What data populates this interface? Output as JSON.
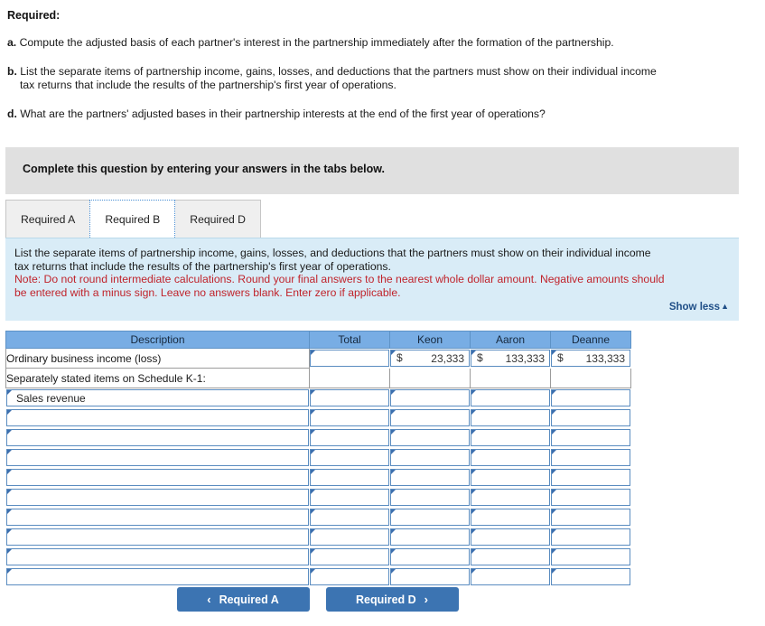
{
  "prompt": {
    "heading": "Required:",
    "items": [
      {
        "label": "a.",
        "text": "Compute the adjusted basis of each partner's interest in the partnership immediately after the formation of the partnership.",
        "cont": ""
      },
      {
        "label": "b.",
        "text": "List the separate items of partnership income, gains, losses, and deductions that the partners must show on their individual income",
        "cont": "tax returns that include the results of the partnership's first year of operations."
      },
      {
        "label": "d.",
        "text": "What are the partners' adjusted bases in their partnership interests at the end of the first year of operations?",
        "cont": ""
      }
    ]
  },
  "banner": {
    "text": "Complete this question by entering your answers in the tabs below."
  },
  "tabs": [
    {
      "label": "Required A",
      "active": false
    },
    {
      "label": "Required B",
      "active": true
    },
    {
      "label": "Required D",
      "active": false
    }
  ],
  "instructions": {
    "line1": "List the separate items of partnership income, gains, losses, and deductions that the partners must show on their individual income",
    "line2": "tax returns that include the results of the partnership's first year of operations.",
    "note1": "Note: Do not round intermediate calculations. Round your final answers to the nearest whole dollar amount. Negative amounts should",
    "note2": "be entered with a minus sign. Leave no answers blank. Enter zero if applicable.",
    "show_less": "Show less",
    "show_less_caret": "▲"
  },
  "table": {
    "headers": [
      "Description",
      "Total",
      "Keon",
      "Aaron",
      "Deanne"
    ],
    "rows": [
      {
        "kind": "static",
        "description": "Ordinary business income (loss)",
        "total": {
          "type": "input",
          "dollar": "",
          "value": ""
        },
        "keon": {
          "type": "input",
          "dollar": "$",
          "value": "23,333"
        },
        "aaron": {
          "type": "input",
          "dollar": "$",
          "value": "133,333"
        },
        "deanne": {
          "type": "input",
          "dollar": "$",
          "value": "133,333"
        }
      },
      {
        "kind": "static",
        "description": "Separately stated items on Schedule K-1:",
        "total": {
          "type": "blank"
        },
        "keon": {
          "type": "blank"
        },
        "aaron": {
          "type": "blank"
        },
        "deanne": {
          "type": "blank"
        }
      },
      {
        "kind": "input",
        "description": "   Sales revenue",
        "total": {
          "type": "input",
          "dollar": "",
          "value": ""
        },
        "keon": {
          "type": "input",
          "dollar": "",
          "value": ""
        },
        "aaron": {
          "type": "input",
          "dollar": "",
          "value": ""
        },
        "deanne": {
          "type": "input",
          "dollar": "",
          "value": ""
        }
      },
      {
        "kind": "input",
        "description": "",
        "total": {
          "type": "input",
          "dollar": "",
          "value": ""
        },
        "keon": {
          "type": "input",
          "dollar": "",
          "value": ""
        },
        "aaron": {
          "type": "input",
          "dollar": "",
          "value": ""
        },
        "deanne": {
          "type": "input",
          "dollar": "",
          "value": ""
        }
      },
      {
        "kind": "input",
        "description": "",
        "total": {
          "type": "input",
          "dollar": "",
          "value": ""
        },
        "keon": {
          "type": "input",
          "dollar": "",
          "value": ""
        },
        "aaron": {
          "type": "input",
          "dollar": "",
          "value": ""
        },
        "deanne": {
          "type": "input",
          "dollar": "",
          "value": ""
        }
      },
      {
        "kind": "input",
        "description": "",
        "total": {
          "type": "input",
          "dollar": "",
          "value": ""
        },
        "keon": {
          "type": "input",
          "dollar": "",
          "value": ""
        },
        "aaron": {
          "type": "input",
          "dollar": "",
          "value": ""
        },
        "deanne": {
          "type": "input",
          "dollar": "",
          "value": ""
        }
      },
      {
        "kind": "input",
        "description": "",
        "total": {
          "type": "input",
          "dollar": "",
          "value": ""
        },
        "keon": {
          "type": "input",
          "dollar": "",
          "value": ""
        },
        "aaron": {
          "type": "input",
          "dollar": "",
          "value": ""
        },
        "deanne": {
          "type": "input",
          "dollar": "",
          "value": ""
        }
      },
      {
        "kind": "input",
        "description": "",
        "total": {
          "type": "input",
          "dollar": "",
          "value": ""
        },
        "keon": {
          "type": "input",
          "dollar": "",
          "value": ""
        },
        "aaron": {
          "type": "input",
          "dollar": "",
          "value": ""
        },
        "deanne": {
          "type": "input",
          "dollar": "",
          "value": ""
        }
      },
      {
        "kind": "input",
        "description": "",
        "total": {
          "type": "input",
          "dollar": "",
          "value": ""
        },
        "keon": {
          "type": "input",
          "dollar": "",
          "value": ""
        },
        "aaron": {
          "type": "input",
          "dollar": "",
          "value": ""
        },
        "deanne": {
          "type": "input",
          "dollar": "",
          "value": ""
        }
      },
      {
        "kind": "input",
        "description": "",
        "total": {
          "type": "input",
          "dollar": "",
          "value": ""
        },
        "keon": {
          "type": "input",
          "dollar": "",
          "value": ""
        },
        "aaron": {
          "type": "input",
          "dollar": "",
          "value": ""
        },
        "deanne": {
          "type": "input",
          "dollar": "",
          "value": ""
        }
      },
      {
        "kind": "input",
        "description": "",
        "total": {
          "type": "input",
          "dollar": "",
          "value": ""
        },
        "keon": {
          "type": "input",
          "dollar": "",
          "value": ""
        },
        "aaron": {
          "type": "input",
          "dollar": "",
          "value": ""
        },
        "deanne": {
          "type": "input",
          "dollar": "",
          "value": ""
        }
      },
      {
        "kind": "input",
        "description": "",
        "total": {
          "type": "input",
          "dollar": "",
          "value": ""
        },
        "keon": {
          "type": "input",
          "dollar": "",
          "value": ""
        },
        "aaron": {
          "type": "input",
          "dollar": "",
          "value": ""
        },
        "deanne": {
          "type": "input",
          "dollar": "",
          "value": ""
        }
      }
    ]
  },
  "nav": {
    "prev_label": "Required A",
    "prev_chevron": "‹",
    "next_label": "Required D",
    "next_chevron": "›"
  },
  "colors": {
    "table_header_blue": "#78ade4",
    "instruction_panel_blue": "#d9ecf7",
    "note_red": "#c0232b",
    "button_blue": "#3c74b2",
    "banner_gray": "#e0e0e0",
    "link_blue": "#1f4e87"
  }
}
